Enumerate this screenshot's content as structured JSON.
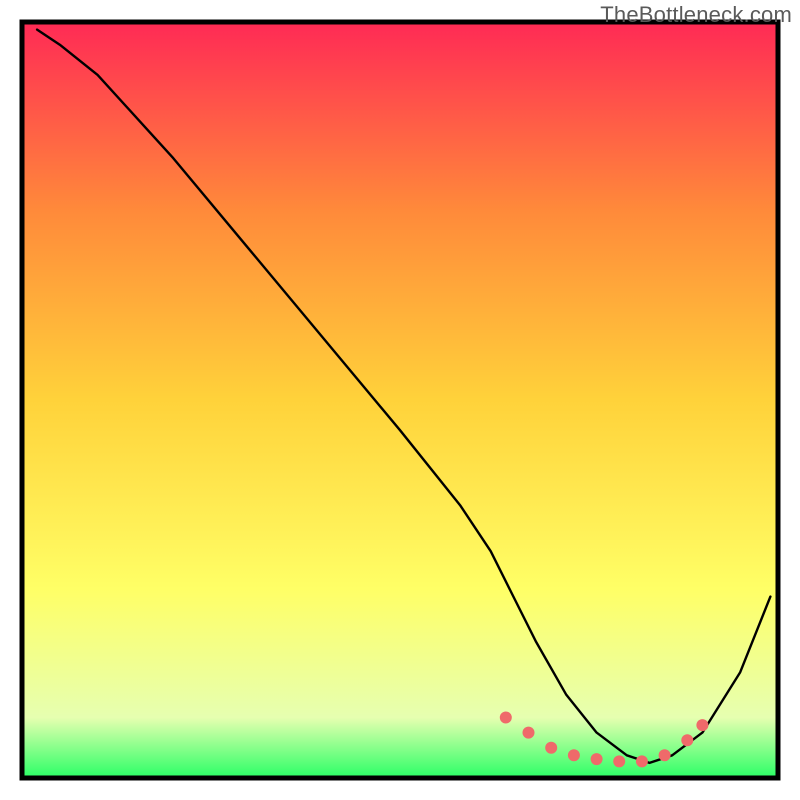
{
  "watermark": "TheBottleneck.com",
  "chart_data": {
    "type": "line",
    "title": "",
    "xlabel": "",
    "ylabel": "",
    "xlim": [
      0,
      100
    ],
    "ylim": [
      0,
      100
    ],
    "background_gradient": {
      "top": "#ff2a55",
      "upper_mid": "#ff8a3a",
      "mid": "#ffd23a",
      "lower_mid": "#ffff66",
      "lower": "#e6ffb0",
      "bottom": "#2aff66"
    },
    "series": [
      {
        "name": "curve",
        "stroke": "#000000",
        "x": [
          2,
          5,
          10,
          20,
          30,
          40,
          50,
          58,
          62,
          65,
          68,
          72,
          76,
          80,
          83,
          86,
          90,
          95,
          99
        ],
        "y": [
          99,
          97,
          93,
          82,
          70,
          58,
          46,
          36,
          30,
          24,
          18,
          11,
          6,
          3,
          2,
          3,
          6,
          14,
          24
        ]
      }
    ],
    "markers": {
      "color": "#ef6a6a",
      "points": [
        {
          "x": 64,
          "y": 8
        },
        {
          "x": 67,
          "y": 6
        },
        {
          "x": 70,
          "y": 4
        },
        {
          "x": 73,
          "y": 3
        },
        {
          "x": 76,
          "y": 2.5
        },
        {
          "x": 79,
          "y": 2.2
        },
        {
          "x": 82,
          "y": 2.2
        },
        {
          "x": 85,
          "y": 3
        },
        {
          "x": 88,
          "y": 5
        },
        {
          "x": 90,
          "y": 7
        }
      ]
    },
    "frame": {
      "stroke": "#000000",
      "width": 5
    }
  }
}
